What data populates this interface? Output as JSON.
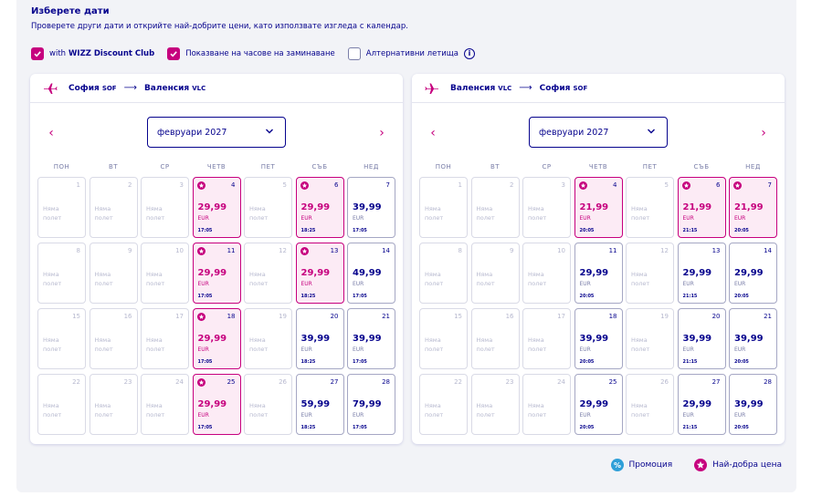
{
  "header": {
    "title": "Изберете дати",
    "subtitle": "Проверете други дати и открийте най-добрите цени, като използвате изгледа с календар."
  },
  "options": [
    {
      "label_pre": "with ",
      "label_bold": "WIZZ Discount Club",
      "checked": true
    },
    {
      "label_pre": "Показване на часове на заминаване",
      "label_bold": "",
      "checked": true
    },
    {
      "label_pre": "Алтернативни летища",
      "label_bold": "",
      "checked": false
    }
  ],
  "weekdays": [
    "ПОН",
    "ВТ",
    "СР",
    "ЧЕТВ",
    "ПЕТ",
    "СЪБ",
    "НЕД"
  ],
  "no_flight_line1": "Няма",
  "no_flight_line2": "полет",
  "colors": {
    "brand_pink": "#c6007e",
    "navy": "#06038d",
    "promo_teal": "#2f9fd8"
  },
  "panels": [
    {
      "from_city": "София",
      "from_code": "SOF",
      "to_city": "Валенсия",
      "to_code": "VLC",
      "month": "февруари 2027",
      "days": [
        {
          "day": "1"
        },
        {
          "day": "2"
        },
        {
          "day": "3"
        },
        {
          "day": "4",
          "price": "29,99",
          "cur": "EUR",
          "time": "17:05",
          "best": true
        },
        {
          "day": "5"
        },
        {
          "day": "6",
          "price": "29,99",
          "cur": "EUR",
          "time": "18:25",
          "best": true
        },
        {
          "day": "7",
          "price": "39,99",
          "cur": "EUR",
          "time": "17:05"
        },
        {
          "day": "8"
        },
        {
          "day": "9"
        },
        {
          "day": "10"
        },
        {
          "day": "11",
          "price": "29,99",
          "cur": "EUR",
          "time": "17:05",
          "best": true
        },
        {
          "day": "12"
        },
        {
          "day": "13",
          "price": "29,99",
          "cur": "EUR",
          "time": "18:25",
          "best": true
        },
        {
          "day": "14",
          "price": "49,99",
          "cur": "EUR",
          "time": "17:05"
        },
        {
          "day": "15"
        },
        {
          "day": "16"
        },
        {
          "day": "17"
        },
        {
          "day": "18",
          "price": "29,99",
          "cur": "EUR",
          "time": "17:05",
          "best": true
        },
        {
          "day": "19"
        },
        {
          "day": "20",
          "price": "39,99",
          "cur": "EUR",
          "time": "18:25"
        },
        {
          "day": "21",
          "price": "39,99",
          "cur": "EUR",
          "time": "17:05"
        },
        {
          "day": "22"
        },
        {
          "day": "23"
        },
        {
          "day": "24"
        },
        {
          "day": "25",
          "price": "29,99",
          "cur": "EUR",
          "time": "17:05",
          "best": true
        },
        {
          "day": "26"
        },
        {
          "day": "27",
          "price": "59,99",
          "cur": "EUR",
          "time": "18:25"
        },
        {
          "day": "28",
          "price": "79,99",
          "cur": "EUR",
          "time": "17:05"
        }
      ]
    },
    {
      "from_city": "Валенсия",
      "from_code": "VLC",
      "to_city": "София",
      "to_code": "SOF",
      "month": "февруари 2027",
      "days": [
        {
          "day": "1"
        },
        {
          "day": "2"
        },
        {
          "day": "3"
        },
        {
          "day": "4",
          "price": "21,99",
          "cur": "EUR",
          "time": "20:05",
          "best": true
        },
        {
          "day": "5"
        },
        {
          "day": "6",
          "price": "21,99",
          "cur": "EUR",
          "time": "21:15",
          "best": true
        },
        {
          "day": "7",
          "price": "21,99",
          "cur": "EUR",
          "time": "20:05",
          "best": true
        },
        {
          "day": "8"
        },
        {
          "day": "9"
        },
        {
          "day": "10"
        },
        {
          "day": "11",
          "price": "29,99",
          "cur": "EUR",
          "time": "20:05"
        },
        {
          "day": "12"
        },
        {
          "day": "13",
          "price": "29,99",
          "cur": "EUR",
          "time": "21:15"
        },
        {
          "day": "14",
          "price": "29,99",
          "cur": "EUR",
          "time": "20:05"
        },
        {
          "day": "15"
        },
        {
          "day": "16"
        },
        {
          "day": "17"
        },
        {
          "day": "18",
          "price": "39,99",
          "cur": "EUR",
          "time": "20:05"
        },
        {
          "day": "19"
        },
        {
          "day": "20",
          "price": "39,99",
          "cur": "EUR",
          "time": "21:15"
        },
        {
          "day": "21",
          "price": "39,99",
          "cur": "EUR",
          "time": "20:05"
        },
        {
          "day": "22"
        },
        {
          "day": "23"
        },
        {
          "day": "24"
        },
        {
          "day": "25",
          "price": "29,99",
          "cur": "EUR",
          "time": "20:05"
        },
        {
          "day": "26"
        },
        {
          "day": "27",
          "price": "29,99",
          "cur": "EUR",
          "time": "21:15"
        },
        {
          "day": "28",
          "price": "39,99",
          "cur": "EUR",
          "time": "20:05"
        }
      ]
    }
  ],
  "legend": {
    "promo": "Промоция",
    "best": "Най-добра цена"
  }
}
